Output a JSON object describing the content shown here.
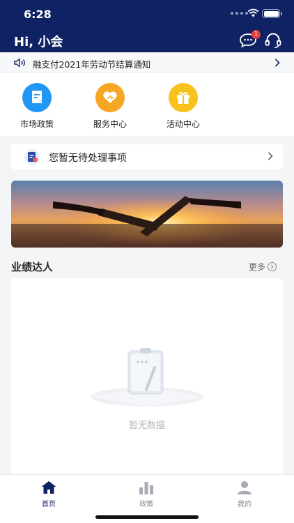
{
  "status": {
    "time": "6:28"
  },
  "header": {
    "greeting": "Hi, 小会",
    "message_badge": "1"
  },
  "notice": {
    "text": "融支付2021年劳动节结算通知"
  },
  "quick_actions": [
    {
      "label": "市场政策",
      "icon": "document-icon",
      "color": "#2196f3"
    },
    {
      "label": "服务中心",
      "icon": "heart-icon",
      "color": "#f5a623"
    },
    {
      "label": "活动中心",
      "icon": "gift-icon",
      "color": "#f8c21d"
    }
  ],
  "todo": {
    "text": "您暂无待处理事项"
  },
  "section": {
    "title": "业绩达人",
    "more": "更多"
  },
  "empty": {
    "text": "暂无数据"
  },
  "tabs": [
    {
      "label": "首页",
      "icon": "home-icon",
      "active": true
    },
    {
      "label": "政策",
      "icon": "chart-icon",
      "active": false
    },
    {
      "label": "我的",
      "icon": "user-icon",
      "active": false
    }
  ],
  "colors": {
    "primary": "#0f2263",
    "background": "#f4f5f7"
  }
}
